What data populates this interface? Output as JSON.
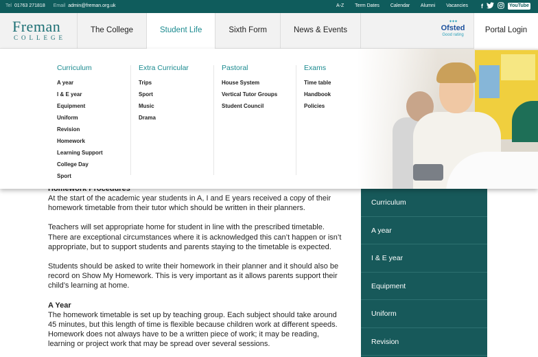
{
  "topbar": {
    "tel_label": "Tel",
    "tel": "01763 271818",
    "email_label": "Email",
    "email": "admin@freman.org.uk",
    "links": [
      "A-Z",
      "Term Dates",
      "Calendar",
      "Alumni",
      "Vacancies"
    ],
    "social": {
      "facebook": "f",
      "twitter": "t",
      "instagram": "◎",
      "youtube": "YouTube"
    }
  },
  "header": {
    "logo_name": "Freman",
    "logo_sub": "COLLEGE",
    "nav": [
      {
        "label": "The College"
      },
      {
        "label": "Student Life"
      },
      {
        "label": "Sixth Form"
      },
      {
        "label": "News & Events"
      }
    ],
    "ofsted_title": "Ofsted",
    "ofsted_rating": "Good rating",
    "portal_label": "Portal Login"
  },
  "mega_menu": {
    "columns": [
      {
        "heading": "Curriculum",
        "links": [
          "A year",
          "I & E year",
          "Equipment",
          "Uniform",
          "Revision",
          "Homework",
          "Learning Support",
          "College Day",
          "Sport"
        ]
      },
      {
        "heading": "Extra Curricular",
        "links": [
          "Trips",
          "Sport",
          "Music",
          "Drama"
        ]
      },
      {
        "heading": "Pastoral",
        "links": [
          "House System",
          "Vertical Tutor Groups",
          "Student Council"
        ]
      },
      {
        "heading": "Exams",
        "links": [
          "Time table",
          "Handbook",
          "Policies"
        ]
      }
    ]
  },
  "article": {
    "heading": "Homework Procedures",
    "paragraphs": [
      "At the start of the academic year students in A, I and E years received a copy of their homework timetable from their tutor which should be written in their planners.",
      "Teachers will set appropriate home for student in line with the prescribed timetable. There are exceptional circumstances where it is acknowledged this can’t happen or isn’t appropriate, but to support students and parents staying to the timetable is expected.",
      "Students should be asked to write their homework in their planner and it should also be record on Show My Homework. This is very important as it allows parents support their child’s learning at home."
    ],
    "heading2": "A Year",
    "paragraph2": "The homework timetable is set up by teaching group. Each subject should take around 45 minutes, but this length of time is flexible because children work at different speeds.  Homework does not always have to be a written piece of work; it may be reading, learning or project work that may be spread over several sessions."
  },
  "sidebar": {
    "items": [
      "Curriculum",
      "A year",
      "I & E year",
      "Equipment",
      "Uniform",
      "Revision"
    ]
  },
  "colors": {
    "teal_dark": "#0f5c5c",
    "teal_sidebar": "#17595a",
    "teal_accent": "#1a8a8f"
  }
}
